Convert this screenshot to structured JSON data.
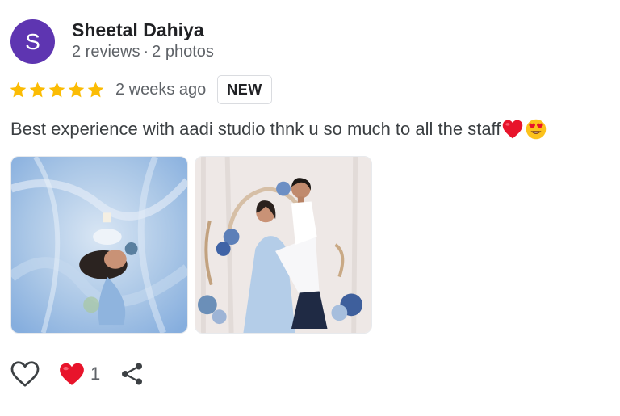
{
  "reviewer": {
    "avatar_letter": "S",
    "avatar_color": "#5e35b1",
    "name": "Sheetal Dahiya",
    "reviews": "2 reviews",
    "separator": "·",
    "photos": "2 photos"
  },
  "rating": {
    "stars": 5,
    "max_stars": 5,
    "star_color": "#fbbc04",
    "time": "2 weeks ago",
    "badge": "NEW"
  },
  "review": {
    "text": "Best experience with aadi studio thnk u so much to all the staff",
    "emojis": [
      "red-heart-emoji",
      "heart-eyes-emoji"
    ]
  },
  "photos": [
    {
      "icon": "maternity-photo-blue-tulle"
    },
    {
      "icon": "couple-maternity-photo"
    }
  ],
  "actions": {
    "like_count": "1",
    "icons": [
      "heart-outline-icon",
      "heart-filled-icon",
      "share-icon"
    ]
  }
}
